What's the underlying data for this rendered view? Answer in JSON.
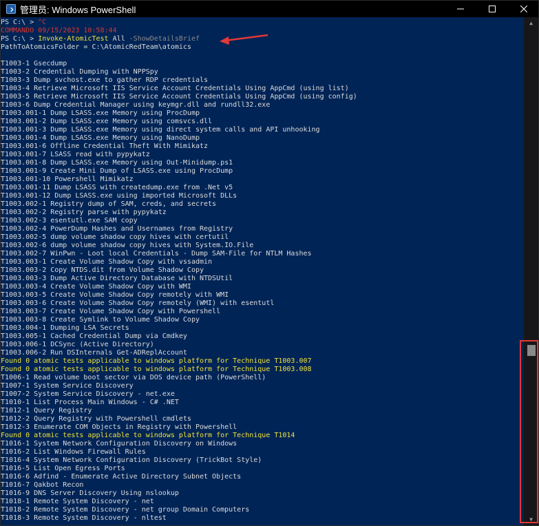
{
  "window": {
    "title": "管理员: Windows PowerShell"
  },
  "controls": {
    "minimize": "—",
    "maximize": "☐",
    "close": "✕"
  },
  "console_lines": [
    {
      "text": "PS C:\\ > ^C",
      "color": "white"
    },
    {
      "text": "COMMANDO 09/15/2023 10:58:44",
      "color": "red"
    },
    {
      "text": "PS C:\\ > Invoke-AtomicTest All -ShowDetailsBrief",
      "color": "white"
    },
    {
      "text": "PathToAtomicsFolder = C:\\AtomicRedTeam\\atomics",
      "color": "white"
    },
    {
      "text": "",
      "color": "white"
    },
    {
      "text": "T1003-1 Gsecdump",
      "color": "white"
    },
    {
      "text": "T1003-2 Credential Dumping with NPPSpy",
      "color": "white"
    },
    {
      "text": "T1003-3 Dump svchost.exe to gather RDP credentials",
      "color": "white"
    },
    {
      "text": "T1003-4 Retrieve Microsoft IIS Service Account Credentials Using AppCmd (using list)",
      "color": "white"
    },
    {
      "text": "T1003-5 Retrieve Microsoft IIS Service Account Credentials Using AppCmd (using config)",
      "color": "white"
    },
    {
      "text": "T1003-6 Dump Credential Manager using keymgr.dll and rundll32.exe",
      "color": "white"
    },
    {
      "text": "T1003.001-1 Dump LSASS.exe Memory using ProcDump",
      "color": "white"
    },
    {
      "text": "T1003.001-2 Dump LSASS.exe Memory using comsvcs.dll",
      "color": "white"
    },
    {
      "text": "T1003.001-3 Dump LSASS.exe Memory using direct system calls and API unhooking",
      "color": "white"
    },
    {
      "text": "T1003.001-4 Dump LSASS.exe Memory using NanoDump",
      "color": "white"
    },
    {
      "text": "T1003.001-6 Offline Credential Theft With Mimikatz",
      "color": "white"
    },
    {
      "text": "T1003.001-7 LSASS read with pypykatz",
      "color": "white"
    },
    {
      "text": "T1003.001-8 Dump LSASS.exe Memory using Out-Minidump.ps1",
      "color": "white"
    },
    {
      "text": "T1003.001-9 Create Mini Dump of LSASS.exe using ProcDump",
      "color": "white"
    },
    {
      "text": "T1003.001-10 Powershell Mimikatz",
      "color": "white"
    },
    {
      "text": "T1003.001-11 Dump LSASS with createdump.exe from .Net v5",
      "color": "white"
    },
    {
      "text": "T1003.001-12 Dump LSASS.exe using imported Microsoft DLLs",
      "color": "white"
    },
    {
      "text": "T1003.002-1 Registry dump of SAM, creds, and secrets",
      "color": "white"
    },
    {
      "text": "T1003.002-2 Registry parse with pypykatz",
      "color": "white"
    },
    {
      "text": "T1003.002-3 esentutl.exe SAM copy",
      "color": "white"
    },
    {
      "text": "T1003.002-4 PowerDump Hashes and Usernames from Registry",
      "color": "white"
    },
    {
      "text": "T1003.002-5 dump volume shadow copy hives with certutil",
      "color": "white"
    },
    {
      "text": "T1003.002-6 dump volume shadow copy hives with System.IO.File",
      "color": "white"
    },
    {
      "text": "T1003.002-7 WinPwn - Loot local Credentials - Dump SAM-File for NTLM Hashes",
      "color": "white"
    },
    {
      "text": "T1003.003-1 Create Volume Shadow Copy with vssadmin",
      "color": "white"
    },
    {
      "text": "T1003.003-2 Copy NTDS.dit from Volume Shadow Copy",
      "color": "white"
    },
    {
      "text": "T1003.003-3 Dump Active Directory Database with NTDSUtil",
      "color": "white"
    },
    {
      "text": "T1003.003-4 Create Volume Shadow Copy with WMI",
      "color": "white"
    },
    {
      "text": "T1003.003-5 Create Volume Shadow Copy remotely with WMI",
      "color": "white"
    },
    {
      "text": "T1003.003-6 Create Volume Shadow Copy remotely (WMI) with esentutl",
      "color": "white"
    },
    {
      "text": "T1003.003-7 Create Volume Shadow Copy with Powershell",
      "color": "white"
    },
    {
      "text": "T1003.003-8 Create Symlink to Volume Shadow Copy",
      "color": "white"
    },
    {
      "text": "T1003.004-1 Dumping LSA Secrets",
      "color": "white"
    },
    {
      "text": "T1003.005-1 Cached Credential Dump via Cmdkey",
      "color": "white"
    },
    {
      "text": "T1003.006-1 DCSync (Active Directory)",
      "color": "white"
    },
    {
      "text": "T1003.006-2 Run DSInternals Get-ADReplAccount",
      "color": "white"
    },
    {
      "text": "Found 0 atomic tests applicable to windows platform for Technique T1003.007",
      "color": "yellow"
    },
    {
      "text": "Found 0 atomic tests applicable to windows platform for Technique T1003.008",
      "color": "yellow"
    },
    {
      "text": "T1006-1 Read volume boot sector via DOS device path (PowerShell)",
      "color": "white"
    },
    {
      "text": "T1007-1 System Service Discovery",
      "color": "white"
    },
    {
      "text": "T1007-2 System Service Discovery - net.exe",
      "color": "white"
    },
    {
      "text": "T1010-1 List Process Main Windows - C# .NET",
      "color": "white"
    },
    {
      "text": "T1012-1 Query Registry",
      "color": "white"
    },
    {
      "text": "T1012-2 Query Registry with Powershell cmdlets",
      "color": "white"
    },
    {
      "text": "T1012-3 Enumerate COM Objects in Registry with Powershell",
      "color": "white"
    },
    {
      "text": "Found 0 atomic tests applicable to windows platform for Technique T1014",
      "color": "yellow"
    },
    {
      "text": "T1016-1 System Network Configuration Discovery on Windows",
      "color": "white"
    },
    {
      "text": "T1016-2 List Windows Firewall Rules",
      "color": "white"
    },
    {
      "text": "T1016-4 System Network Configuration Discovery (TrickBot Style)",
      "color": "white"
    },
    {
      "text": "T1016-5 List Open Egress Ports",
      "color": "white"
    },
    {
      "text": "T1016-6 Adfind - Enumerate Active Directory Subnet Objects",
      "color": "white"
    },
    {
      "text": "T1016-7 Qakbot Recon",
      "color": "white"
    },
    {
      "text": "T1016-9 DNS Server Discovery Using nslookup",
      "color": "white"
    },
    {
      "text": "T1018-1 Remote System Discovery - net",
      "color": "white"
    },
    {
      "text": "T1018-2 Remote System Discovery - net group Domain Computers",
      "color": "white"
    },
    {
      "text": "T1018-3 Remote System Discovery - nltest",
      "color": "white"
    }
  ],
  "colors": {
    "background": "#012456",
    "white": "#dcdcdc",
    "red": "#e0352b",
    "yellow": "#f2e33a",
    "command": "#f2e33a",
    "param": "#8a8a8a",
    "annotation": "#e53935"
  }
}
